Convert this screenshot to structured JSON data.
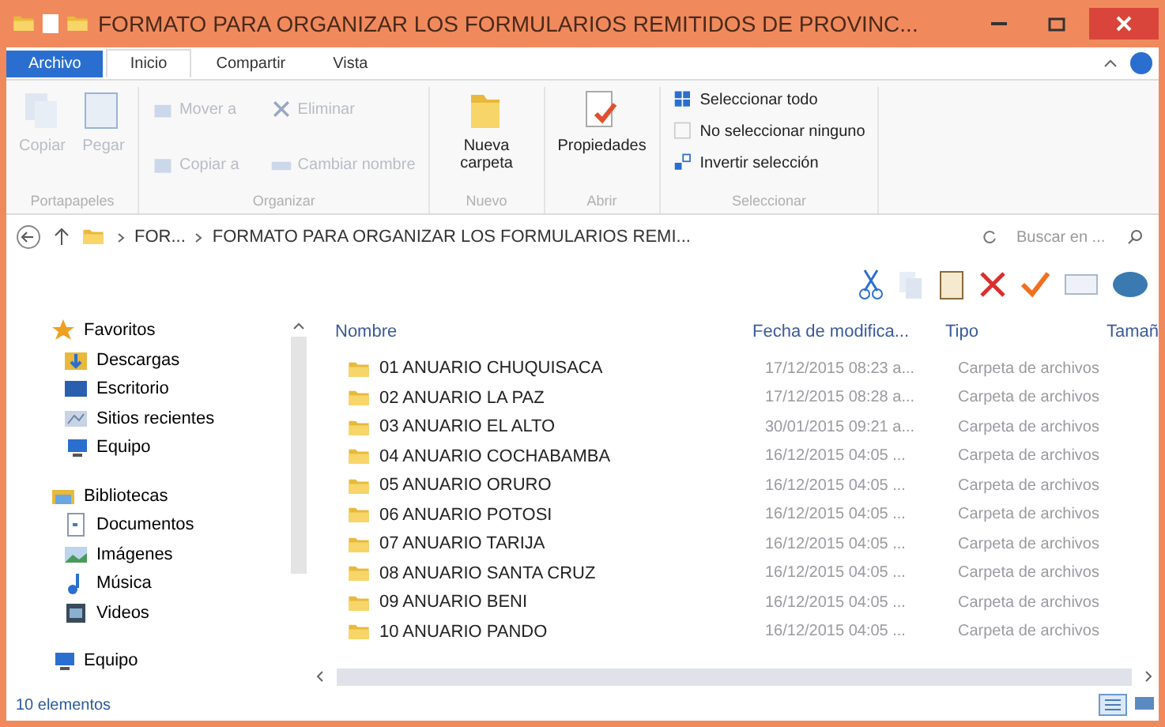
{
  "window": {
    "title": "FORMATO PARA ORGANIZAR LOS FORMULARIOS REMITIDOS DE PROVINC..."
  },
  "tabs": [
    {
      "label": "Archivo",
      "kind": "file",
      "selected": false
    },
    {
      "label": "Inicio",
      "kind": "tab",
      "selected": true
    },
    {
      "label": "Compartir",
      "kind": "tab",
      "selected": false
    },
    {
      "label": "Vista",
      "kind": "tab",
      "selected": false
    }
  ],
  "ribbon": {
    "groups": [
      {
        "label": "Portapapeles",
        "items": [
          {
            "label": "Copiar",
            "kind": "big",
            "disabled": true
          },
          {
            "label": "Pegar",
            "kind": "big",
            "disabled": true
          }
        ]
      },
      {
        "label": "Organizar",
        "items": [
          {
            "label": "Mover a",
            "kind": "small",
            "disabled": true
          },
          {
            "label": "Eliminar",
            "kind": "small",
            "disabled": true
          },
          {
            "label": "Copiar a",
            "kind": "small",
            "disabled": true
          },
          {
            "label": "Cambiar nombre",
            "kind": "small",
            "disabled": true
          }
        ]
      },
      {
        "label": "Nuevo",
        "items": [
          {
            "label": "Nueva carpeta",
            "kind": "big",
            "disabled": false
          }
        ]
      },
      {
        "label": "Abrir",
        "items": [
          {
            "label": "Propiedades",
            "kind": "big",
            "disabled": false
          }
        ]
      },
      {
        "label": "Seleccionar",
        "items": [
          {
            "label": "Seleccionar todo",
            "kind": "line",
            "disabled": false
          },
          {
            "label": "No seleccionar ninguno",
            "kind": "line",
            "disabled": false
          },
          {
            "label": "Invertir selección",
            "kind": "line",
            "disabled": false
          }
        ]
      }
    ]
  },
  "address": {
    "crumbs": [
      "FOR...",
      "FORMATO PARA ORGANIZAR LOS FORMULARIOS REMI..."
    ],
    "search_placeholder": "Buscar en ..."
  },
  "nav": [
    {
      "label": "Favoritos",
      "children": [
        {
          "label": "Descargas"
        },
        {
          "label": "Escritorio"
        },
        {
          "label": "Sitios recientes"
        },
        {
          "label": "Equipo"
        }
      ]
    },
    {
      "label": "Bibliotecas",
      "children": [
        {
          "label": "Documentos"
        },
        {
          "label": "Imágenes"
        },
        {
          "label": "Música"
        },
        {
          "label": "Videos"
        }
      ]
    },
    {
      "label": "Equipo"
    }
  ],
  "table": {
    "columns": [
      "Nombre",
      "Fecha de modifica...",
      "Tipo",
      "Tamañ"
    ],
    "rows": [
      {
        "name": "01 ANUARIO CHUQUISACA",
        "date": "17/12/2015 08:23 a...",
        "type": "Carpeta de archivos"
      },
      {
        "name": "02 ANUARIO LA PAZ",
        "date": "17/12/2015 08:28 a...",
        "type": "Carpeta de archivos"
      },
      {
        "name": "03 ANUARIO EL ALTO",
        "date": "30/01/2015 09:21 a...",
        "type": "Carpeta de archivos"
      },
      {
        "name": "04 ANUARIO COCHABAMBA",
        "date": "16/12/2015 04:05 ...",
        "type": "Carpeta de archivos"
      },
      {
        "name": "05 ANUARIO ORURO",
        "date": "16/12/2015 04:05 ...",
        "type": "Carpeta de archivos"
      },
      {
        "name": "06 ANUARIO POTOSI",
        "date": "16/12/2015 04:05 ...",
        "type": "Carpeta de archivos"
      },
      {
        "name": "07 ANUARIO TARIJA",
        "date": "16/12/2015 04:05 ...",
        "type": "Carpeta de archivos"
      },
      {
        "name": "08 ANUARIO SANTA CRUZ",
        "date": "16/12/2015 04:05 ...",
        "type": "Carpeta de archivos"
      },
      {
        "name": "09 ANUARIO BENI",
        "date": "16/12/2015 04:05 ...",
        "type": "Carpeta de archivos"
      },
      {
        "name": "10 ANUARIO PANDO",
        "date": "16/12/2015 04:05 ...",
        "type": "Carpeta de archivos"
      }
    ]
  },
  "status_bar": {
    "count": "10 elementos"
  }
}
